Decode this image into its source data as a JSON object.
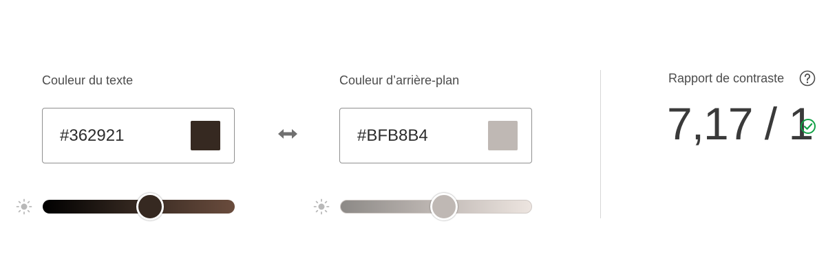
{
  "text_color": {
    "label": "Couleur du texte",
    "hex_value": "#362921",
    "swatch_color": "#362921",
    "track_gradient": [
      "#000000",
      "#362921",
      "#6a4c3d"
    ],
    "slider_position": 0.56
  },
  "background_color": {
    "label": "Couleur d’arrière-plan",
    "hex_value": "#BFB8B4",
    "swatch_color": "#BFB8B4",
    "track_gradient": [
      "#8c8986",
      "#bfb8b4",
      "#ede5e0"
    ],
    "slider_position": 0.54
  },
  "swap": {
    "icon": "swap-horizontal-icon"
  },
  "brightness": {
    "icon": "sun-icon"
  },
  "contrast": {
    "label": "Rapport de contraste",
    "help_icon": "help-circle-icon",
    "value": "7,17 / 1",
    "status_icon": "check-circle-icon",
    "status_color": "#12a146"
  }
}
